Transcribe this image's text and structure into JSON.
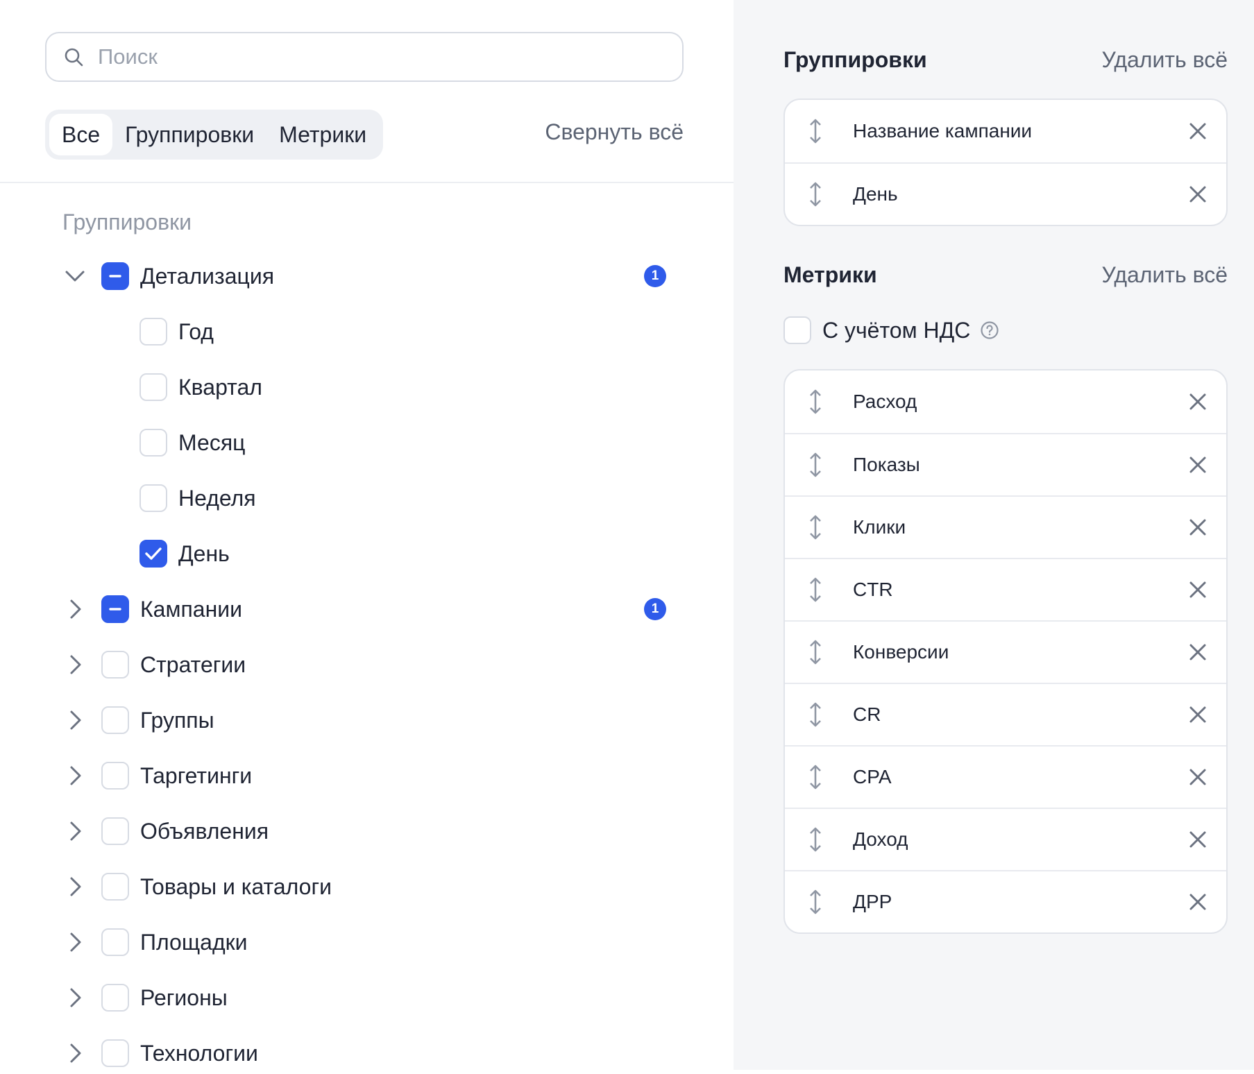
{
  "search": {
    "placeholder": "Поиск"
  },
  "tabs": [
    {
      "label": "Все",
      "active": true
    },
    {
      "label": "Группировки",
      "active": false
    },
    {
      "label": "Метрики",
      "active": false
    }
  ],
  "collapse_all": "Свернуть всё",
  "groups_section_title": "Группировки",
  "tree": {
    "detalization": {
      "label": "Детализация",
      "state": "partial",
      "expanded": true,
      "badge": "1"
    },
    "children": [
      {
        "label": "Год",
        "checked": false
      },
      {
        "label": "Квартал",
        "checked": false
      },
      {
        "label": "Месяц",
        "checked": false
      },
      {
        "label": "Неделя",
        "checked": false
      },
      {
        "label": "День",
        "checked": true
      }
    ],
    "items": [
      {
        "label": "Кампании",
        "state": "partial",
        "badge": "1"
      },
      {
        "label": "Стратегии",
        "state": "unchecked"
      },
      {
        "label": "Группы",
        "state": "unchecked"
      },
      {
        "label": "Таргетинги",
        "state": "unchecked"
      },
      {
        "label": "Объявления",
        "state": "unchecked"
      },
      {
        "label": "Товары и каталоги",
        "state": "unchecked"
      },
      {
        "label": "Площадки",
        "state": "unchecked"
      },
      {
        "label": "Регионы",
        "state": "unchecked"
      },
      {
        "label": "Технологии",
        "state": "unchecked"
      }
    ]
  },
  "right": {
    "groupings_title": "Группировки",
    "groupings_delete_all": "Удалить всё",
    "groupings": [
      "Название кампании",
      "День"
    ],
    "metrics_title": "Метрики",
    "metrics_delete_all": "Удалить всё",
    "vat_label": "С учётом НДС",
    "vat_checked": false,
    "metrics": [
      "Расход",
      "Показы",
      "Клики",
      "CTR",
      "Конверсии",
      "CR",
      "CPA",
      "Доход",
      "ДРР"
    ]
  },
  "colors": {
    "accent": "#2f5bea",
    "panel_bg": "#f5f6f8",
    "muted_text": "#8f96a3"
  }
}
